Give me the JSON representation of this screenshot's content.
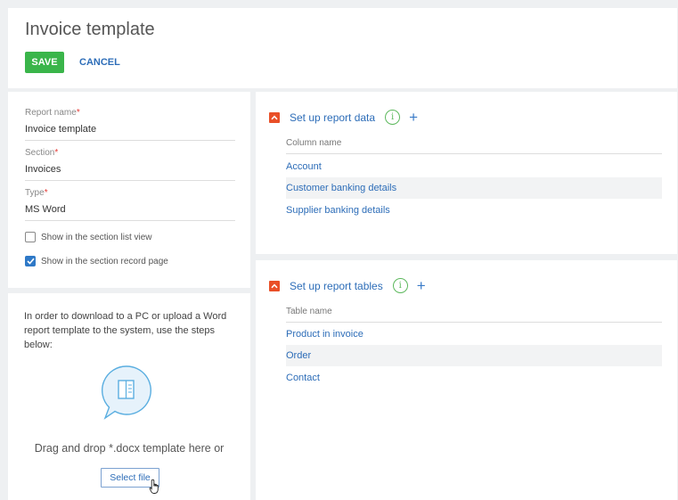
{
  "header": {
    "title": "Invoice template",
    "save_label": "SAVE",
    "cancel_label": "CANCEL"
  },
  "form": {
    "fields": [
      {
        "label": "Report name",
        "value": "Invoice template"
      },
      {
        "label": "Section",
        "value": "Invoices"
      },
      {
        "label": "Type",
        "value": "MS Word"
      }
    ],
    "required_mark": "*",
    "checkboxes": [
      {
        "label": "Show in the section list view",
        "checked": false
      },
      {
        "label": "Show in the section record page",
        "checked": true
      }
    ]
  },
  "upload": {
    "instructions": "In order to download to a PC or upload a Word report template to the system, use the steps below:",
    "drag_text": "Drag and drop *.docx template here or",
    "select_label": "Select file"
  },
  "report_data": {
    "title": "Set up report data",
    "column_header": "Column name",
    "rows": [
      "Account",
      "Customer banking details",
      "Supplier banking details"
    ],
    "highlighted_row": 1
  },
  "report_tables": {
    "title": "Set up report tables",
    "column_header": "Table name",
    "rows": [
      "Product in invoice",
      "Order",
      "Contact"
    ],
    "highlighted_row": 1
  },
  "icons": {
    "info": "info-icon",
    "add": "plus-icon",
    "collapse": "chevron-up-icon",
    "bubble": "document-bubble-icon"
  },
  "colors": {
    "save": "#3ab54a",
    "link": "#2d6db8",
    "collapse": "#e94f27",
    "info": "#5cb85c",
    "checkbox": "#2f79c7",
    "required": "#e53935"
  }
}
